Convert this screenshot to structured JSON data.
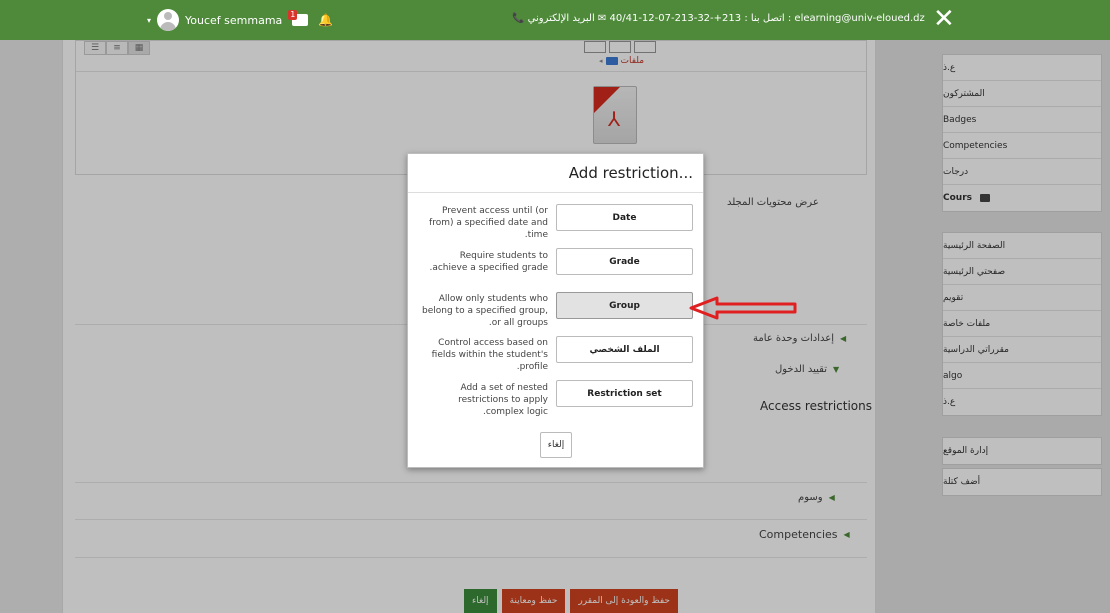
{
  "topbar": {
    "close_icon": "close-icon",
    "contact": "📞 اتصل بنا : 213+-32-213-07-12-40/41 ✉ البريد الإلكتروني : elearning@univ-eloued.dz",
    "username": "Youcef semmama",
    "caret": "▾",
    "message_count": "1",
    "bell": "🔔",
    "color": "#4e8a3a"
  },
  "editor": {
    "folder_label": "ملفات",
    "view_buttons": [
      "☰",
      "≡",
      "▦"
    ]
  },
  "form": {
    "folder_contents_label": "عرض محتويات المجلد",
    "general_settings": "إعدادات وحدة عامة",
    "restrict_access": "تقييد الدخول",
    "access_restrictions": "Access restrictions",
    "tags": "وسوم",
    "competencies": "Competencies",
    "buttons": {
      "save_return": "حفظ والعودة إلى المقرر",
      "save_display": "حفظ ومعاينة",
      "cancel": "إلغاء"
    }
  },
  "sidebar": {
    "group1": [
      "ع.ذ",
      "المشتركون",
      "Badges",
      "Competencies",
      "درجات",
      "Cours"
    ],
    "group2": [
      "الصفحة الرئيسية",
      "صفحتي الرئيسية",
      "تقويم",
      "ملفات خاصة",
      "مقرراتي الدراسية",
      "algo",
      "ع.ذ"
    ],
    "group3": [
      "إدارة الموقع"
    ],
    "group4": [
      "أضف كتلة"
    ]
  },
  "modal": {
    "title": "Add restriction...",
    "options": [
      {
        "desc": "Prevent access until (or from) a specified date and time.",
        "label": "Date"
      },
      {
        "desc": "Require students to achieve a specified grade.",
        "label": "Grade"
      },
      {
        "desc": "Allow only students who belong to a specified group, or all groups.",
        "label": "Group"
      },
      {
        "desc": "Control access based on fields within the student's profile.",
        "label": "الملف الشخصي"
      },
      {
        "desc": "Add a set of nested restrictions to apply complex logic.",
        "label": "Restriction set"
      }
    ],
    "cancel": "إلغاء",
    "arrow_color": "#e02020"
  }
}
